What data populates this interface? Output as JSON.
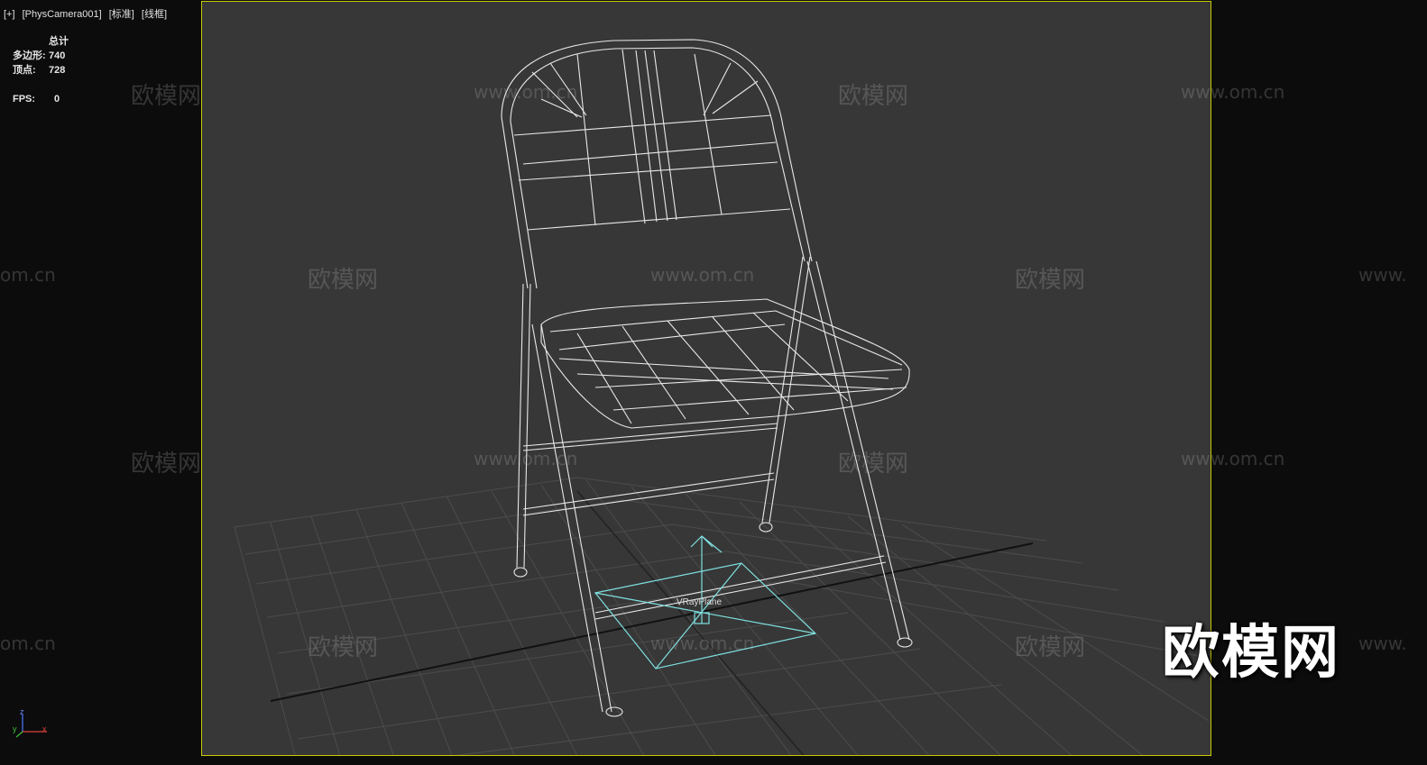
{
  "viewport_menu": {
    "plus": "[+]",
    "camera": "[PhysCamera001]",
    "shading_std": "[标准]",
    "shading_mode": "[线框]"
  },
  "stats": {
    "header": "总计",
    "poly_label": "多边形:",
    "poly_value": "740",
    "vert_label": "顶点:",
    "vert_value": "728",
    "fps_label": "FPS:",
    "fps_value": "0"
  },
  "scene": {
    "object_label": "VRayPlane"
  },
  "axis_tripod": {
    "z": "z",
    "y": "y",
    "x": "x"
  },
  "watermarks": {
    "brand_cn": "欧模网",
    "url": "www.om.cn",
    "url_fragment_left": "om.cn",
    "url_fragment_right": "www."
  },
  "colors": {
    "viewport_bg": "#373737",
    "viewport_border": "#c8c800",
    "wireframe": "#f2f2f2",
    "gizmo": "#7fe0e0",
    "grid": "#4a4a4a"
  }
}
